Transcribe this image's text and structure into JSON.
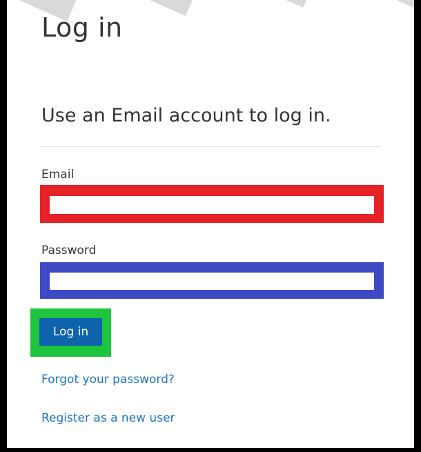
{
  "page": {
    "title": "Log in",
    "subtitle": "Use an Email account to log in."
  },
  "form": {
    "email_label": "Email",
    "email_value": "",
    "password_label": "Password",
    "password_value": "",
    "submit_label": "Log in"
  },
  "links": {
    "forgot_password": "Forgot your password?",
    "register": "Register as a new user"
  },
  "annotations": {
    "email_highlight_color": "#e52228",
    "password_highlight_color": "#3f49c6",
    "button_highlight_color": "#1ec63d"
  },
  "colors": {
    "button_background": "#0f63ad",
    "link": "#1a73c8",
    "text": "#333333"
  }
}
